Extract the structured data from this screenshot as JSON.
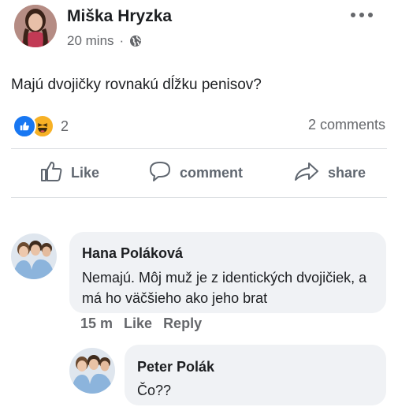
{
  "post": {
    "author_name": "Miška Hryzka",
    "time": "20 mins",
    "separator": "·",
    "audience_icon": "globe-icon",
    "more_icon": "more-options-icon",
    "text": "Majú dvojičky rovnakú dĺžku penisov?",
    "reaction_icons": [
      "like-reaction-icon",
      "haha-reaction-icon"
    ],
    "reaction_count": "2",
    "comments_count": "2 comments"
  },
  "actions": {
    "like_label": "Like",
    "comment_label": "comment",
    "share_label": "share"
  },
  "comments": [
    {
      "author": "Hana Poláková",
      "text": "Nemajú. Môj muž je z identických dvojičiek, a má ho väčšieho ako jeho brat",
      "time": "15 m",
      "like_label": "Like",
      "reply_label": "Reply"
    },
    {
      "author": "Peter Polák",
      "text": "Čo??"
    }
  ],
  "colors": {
    "brand_blue": "#1877f2",
    "haha_yellow": "#f7b125",
    "bubble_bg": "#f0f2f5",
    "secondary_text": "#65676b"
  }
}
